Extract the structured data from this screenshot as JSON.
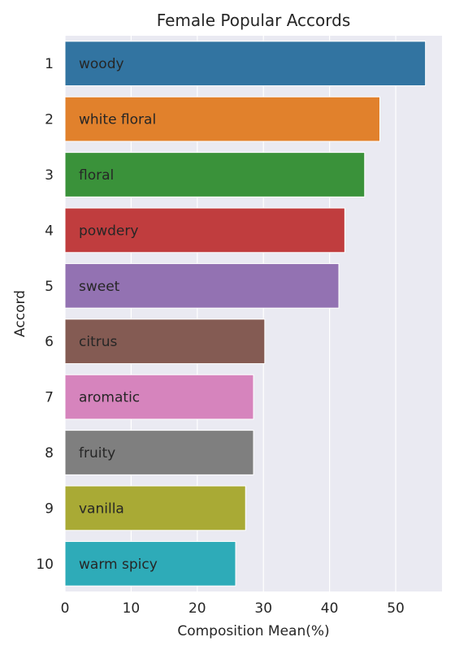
{
  "chart_data": {
    "type": "bar",
    "orientation": "horizontal",
    "title": "Female Popular Accords",
    "xlabel": "Composition Mean(%)",
    "ylabel": "Accord",
    "xlim": [
      0,
      57
    ],
    "xticks": [
      0,
      10,
      20,
      30,
      40,
      50
    ],
    "grid": true,
    "categories": [
      "1",
      "2",
      "3",
      "4",
      "5",
      "6",
      "7",
      "8",
      "9",
      "10"
    ],
    "bar_labels": [
      "woody",
      "white floral",
      "floral",
      "powdery",
      "sweet",
      "citrus",
      "aromatic",
      "fruity",
      "vanilla",
      "warm spicy"
    ],
    "values": [
      54.5,
      47.6,
      45.3,
      42.3,
      41.4,
      30.2,
      28.5,
      28.5,
      27.3,
      25.8
    ],
    "colors": [
      "#3274a1",
      "#e1812c",
      "#3a923a",
      "#c03d3e",
      "#9372b2",
      "#845b53",
      "#d684bd",
      "#7f7f7f",
      "#a9aa35",
      "#2eabb8"
    ],
    "background": "#eaeaf2"
  }
}
